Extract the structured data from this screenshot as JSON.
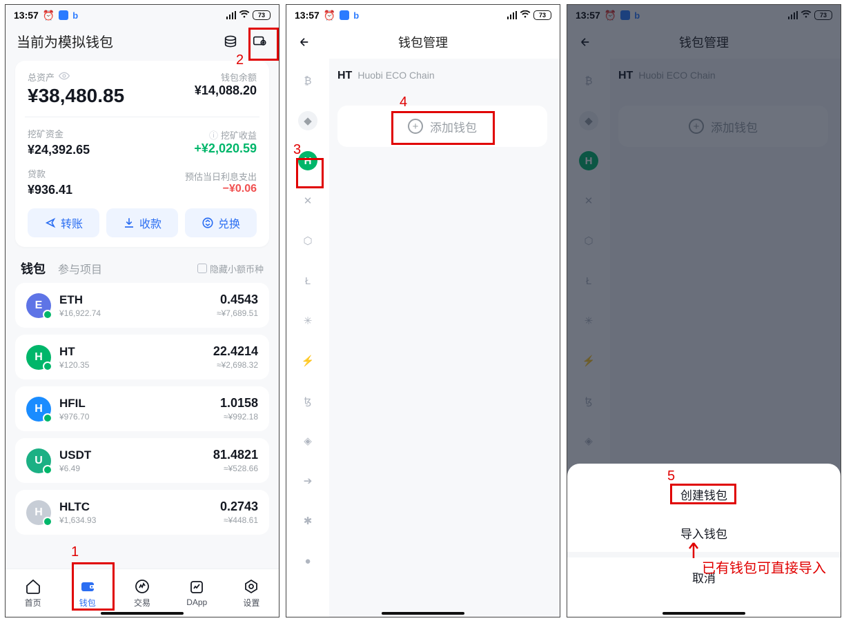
{
  "status": {
    "time": "13:57",
    "battery": "73"
  },
  "annotations": {
    "n1": "1",
    "n2": "2",
    "n3": "3",
    "n4": "4",
    "n5": "5",
    "import_hint": "已有钱包可直接导入"
  },
  "phone1": {
    "header_title": "当前为模拟钱包",
    "total_label": "总资产",
    "total_amount": "¥38,480.85",
    "balance_label": "钱包余额",
    "balance_amount": "¥14,088.20",
    "mining_fund_label": "挖矿资金",
    "mining_fund_amount": "¥24,392.65",
    "mining_income_label": "挖矿收益",
    "mining_income_amount": "+¥2,020.59",
    "loan_label": "贷款",
    "loan_amount": "¥936.41",
    "interest_label": "预估当日利息支出",
    "interest_amount": "−¥0.06",
    "actions": {
      "transfer": "转账",
      "receive": "收款",
      "swap": "兑换"
    },
    "tab_wallet": "钱包",
    "tab_projects": "参与项目",
    "hide_small": "隐藏小额币种",
    "assets": [
      {
        "sym": "ETH",
        "price": "¥16,922.74",
        "amt": "0.4543",
        "val": "≈¥7,689.51",
        "color": "#5e74e6"
      },
      {
        "sym": "HT",
        "price": "¥120.35",
        "amt": "22.4214",
        "val": "≈¥2,698.32",
        "color": "#00b66a"
      },
      {
        "sym": "HFIL",
        "price": "¥976.70",
        "amt": "1.0158",
        "val": "≈¥992.18",
        "color": "#1a8cff"
      },
      {
        "sym": "USDT",
        "price": "¥6.49",
        "amt": "81.4821",
        "val": "≈¥528.66",
        "color": "#1cb084"
      },
      {
        "sym": "HLTC",
        "price": "¥1,634.93",
        "amt": "0.2743",
        "val": "≈¥448.61",
        "color": "#c7cdd6"
      }
    ],
    "nav": {
      "home": "首页",
      "wallet": "钱包",
      "trade": "交易",
      "dapp": "DApp",
      "settings": "设置"
    }
  },
  "phone2": {
    "title": "钱包管理",
    "chain_sym": "HT",
    "chain_name": "Huobi ECO Chain",
    "add_wallet": "添加钱包",
    "chain_icons": [
      "₿",
      "◆",
      "H",
      "✕",
      "⬡",
      "Ł",
      "✳",
      "⚡",
      "ꜩ",
      "◈",
      "➔",
      "✱",
      "●"
    ]
  },
  "phone3": {
    "title": "钱包管理",
    "chain_sym": "HT",
    "chain_name": "Huobi ECO Chain",
    "add_wallet": "添加钱包",
    "sheet": {
      "create": "创建钱包",
      "import": "导入钱包",
      "cancel": "取消"
    }
  }
}
